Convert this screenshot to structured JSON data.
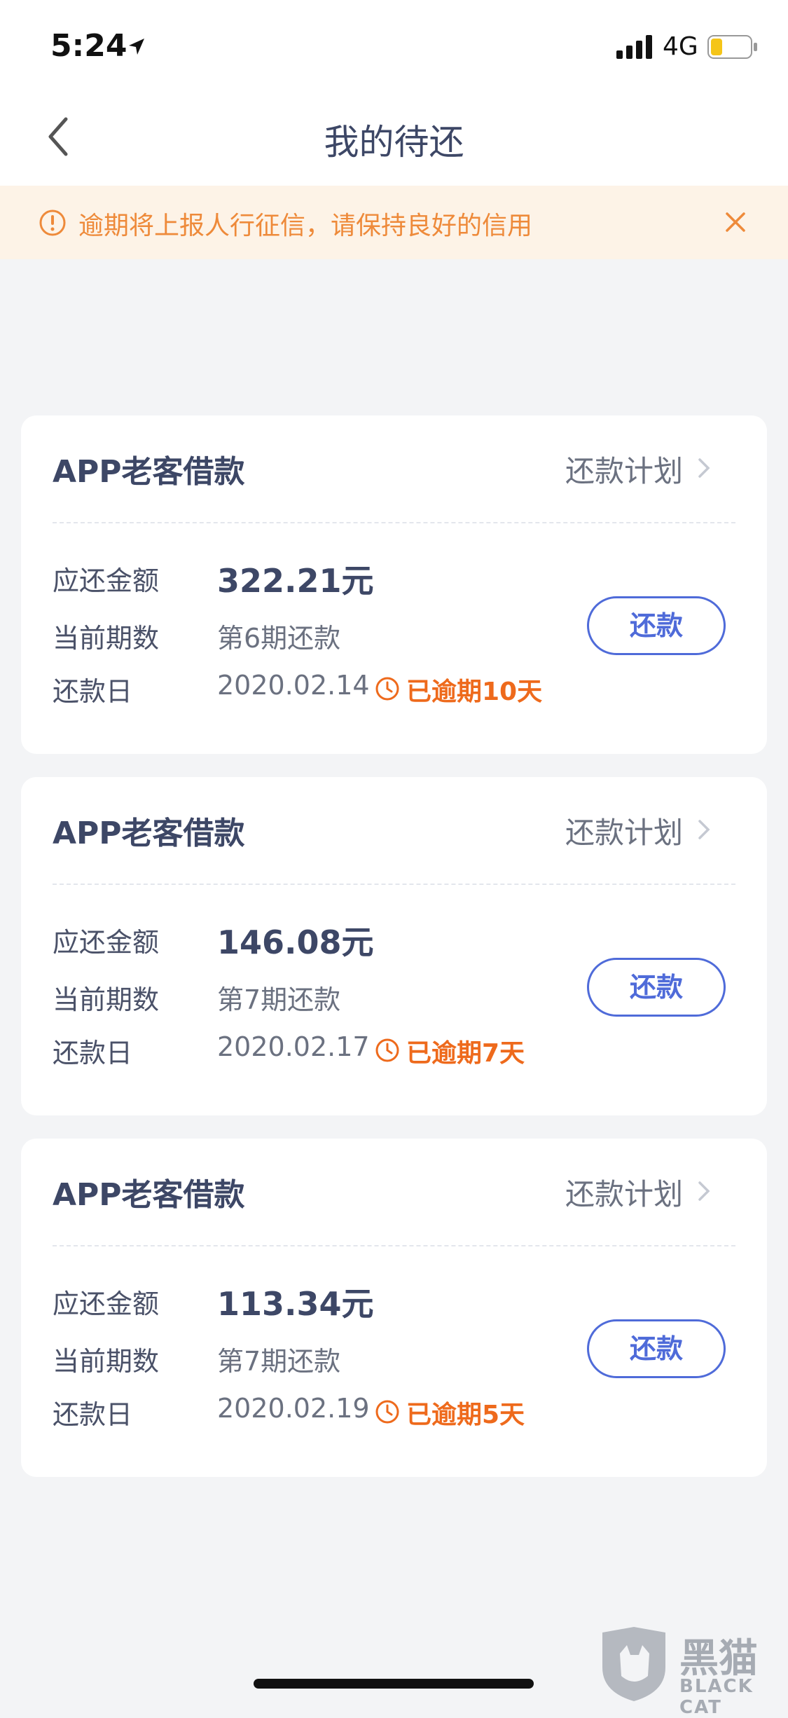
{
  "status_bar": {
    "time": "5:24",
    "network": "4G"
  },
  "header": {
    "title": "我的待还"
  },
  "notice": {
    "text": "逾期将上报人行征信，请保持良好的信用"
  },
  "labels": {
    "amount": "应还金额",
    "period": "当前期数",
    "due_date": "还款日"
  },
  "loans": [
    {
      "title": "APP老客借款",
      "plan_label": "还款计划",
      "amount": "322.21元",
      "period": "第6期还款",
      "date": "2020.02.14",
      "overdue": "已逾期10天",
      "pay_label": "还款"
    },
    {
      "title": "APP老客借款",
      "plan_label": "还款计划",
      "amount": "146.08元",
      "period": "第7期还款",
      "date": "2020.02.17",
      "overdue": "已逾期7天",
      "pay_label": "还款"
    },
    {
      "title": "APP老客借款",
      "plan_label": "还款计划",
      "amount": "113.34元",
      "period": "第7期还款",
      "date": "2020.02.19",
      "overdue": "已逾期5天",
      "pay_label": "还款"
    }
  ],
  "watermark": {
    "text": "黑猫",
    "sub": "BLACK CAT"
  },
  "colors": {
    "accent": "#4f6bd9",
    "warning": "#ee6a1c",
    "notice_bg": "#fdf3e7"
  }
}
